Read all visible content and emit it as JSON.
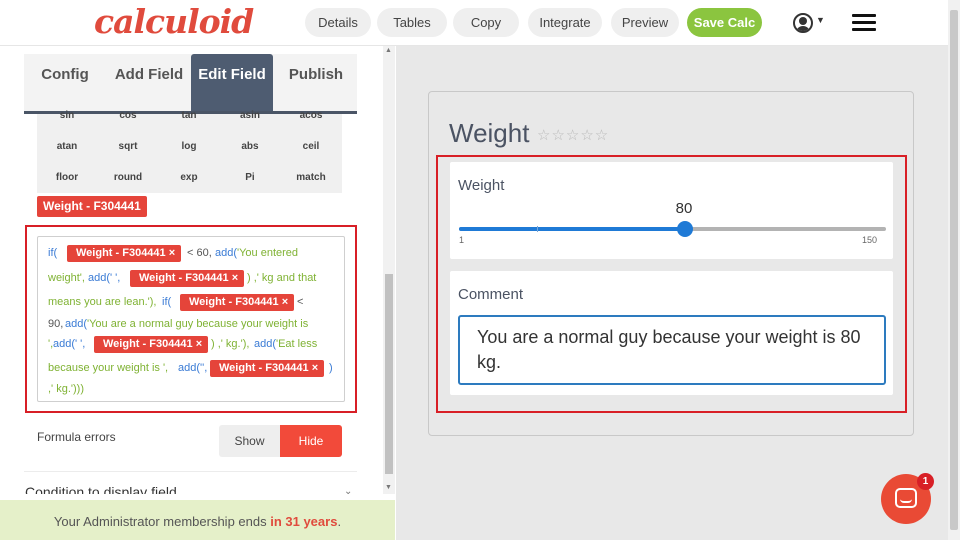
{
  "header": {
    "logo": "calculoid",
    "nav": [
      "Details",
      "Tables",
      "Copy",
      "Integrate",
      "Preview"
    ],
    "save_label": "Save Calc",
    "accent": "#8bc53f",
    "brand_color": "#e04b3d"
  },
  "editor": {
    "tabs": [
      {
        "label": "Config"
      },
      {
        "label": "Add Field"
      },
      {
        "label": "Edit Field",
        "active": true
      },
      {
        "label": "Publish"
      }
    ],
    "functions": [
      [
        "sin",
        "cos",
        "tan",
        "asin",
        "acos"
      ],
      [
        "atan",
        "sqrt",
        "log",
        "abs",
        "ceil"
      ],
      [
        "floor",
        "round",
        "exp",
        "Pi",
        "match"
      ]
    ],
    "field_tag": "Weight - F304441",
    "formula": {
      "l1_a": "if(",
      "tag": "Weight - F304441 ×",
      "l1_b": "< 60,",
      "l1_c": "add(",
      "l1_d": "'You entered",
      "l2_a": "weight',",
      "l2_b": "add(' ',",
      "l2_c": ") ,' kg and that",
      "l3_a": "means you are lean.'),",
      "l3_b": "if(",
      "l3_c": "<",
      "l4_a": "90,",
      "l4_b": "add(",
      "l4_c": "'You are a normal guy because your weight is",
      "l5_a": "',",
      "l5_b": "add(' ',",
      "l5_c": ") ,' kg.'),",
      "l5_d": "add(",
      "l5_e": "'Eat less",
      "l6_a": "because your weight is ',",
      "l6_b": "add('',",
      "l6_c": ")",
      "l7_a": ",' kg.')))"
    },
    "formula_errors_label": "Formula errors",
    "show_label": "Show",
    "hide_label": "Hide",
    "condition_label": "Condition to display field",
    "banner_prefix": "Your Administrator membership ends ",
    "banner_highlight": "in 31 years",
    "banner_suffix": "."
  },
  "preview": {
    "title": "Weight",
    "stars": "☆☆☆☆☆",
    "weight_label": "Weight",
    "slider_value": "80",
    "slider_min": "1",
    "slider_max": "150",
    "slider": {
      "min": 1,
      "max": 150,
      "value": 80
    },
    "comment_label": "Comment",
    "comment_text": "You are a normal guy because your weight is 80 kg."
  },
  "chat": {
    "badge": "1"
  }
}
